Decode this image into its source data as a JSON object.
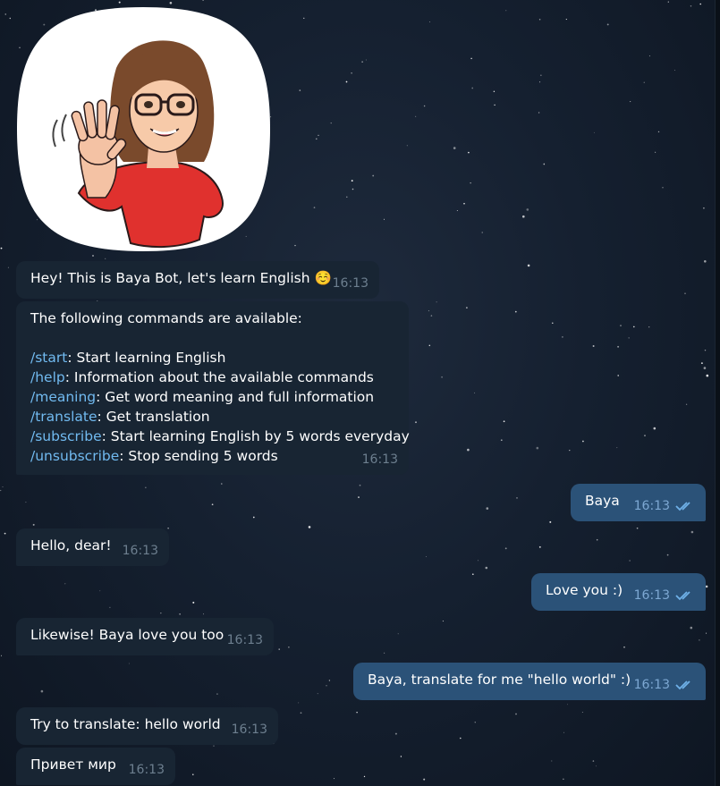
{
  "colors": {
    "background": "#152030",
    "incoming_bubble": "#182533",
    "outgoing_bubble": "#2b5278",
    "link": "#71baf0",
    "time_incoming": "#6d7f8f",
    "time_outgoing": "#7da8d3"
  },
  "sticker": {
    "name": "waving-girl-sticker"
  },
  "messages": [
    {
      "direction": "in",
      "text": "Hey! This is Baya Bot, let's learn English",
      "emoji": "☺️",
      "time": "16:13"
    },
    {
      "direction": "in",
      "intro": "The following commands are available:",
      "commands": [
        {
          "cmd": "/start",
          "desc": ": Start learning English"
        },
        {
          "cmd": "/help",
          "desc": ": Information about the available commands"
        },
        {
          "cmd": "/meaning",
          "desc": ": Get word meaning and full information"
        },
        {
          "cmd": "/translate",
          "desc": ": Get translation"
        },
        {
          "cmd": "/subscribe",
          "desc": ": Start learning English by 5 words everyday"
        },
        {
          "cmd": "/unsubscribe",
          "desc": ": Stop sending 5 words"
        }
      ],
      "time": "16:13"
    },
    {
      "direction": "out",
      "text": "Baya",
      "time": "16:13",
      "read_icon": "double-check-icon"
    },
    {
      "direction": "in",
      "text": "Hello, dear!",
      "time": "16:13"
    },
    {
      "direction": "out",
      "text": "Love you :)",
      "time": "16:13",
      "read_icon": "double-check-icon"
    },
    {
      "direction": "in",
      "text": "Likewise! Baya love you too",
      "time": "16:13"
    },
    {
      "direction": "out",
      "text": "Baya, translate for me \"hello world\" :)",
      "time": "16:13",
      "read_icon": "double-check-icon"
    },
    {
      "direction": "in",
      "text": "Try to translate: hello world",
      "time": "16:13"
    },
    {
      "direction": "in",
      "text": "Привет мир",
      "time": "16:13"
    }
  ]
}
